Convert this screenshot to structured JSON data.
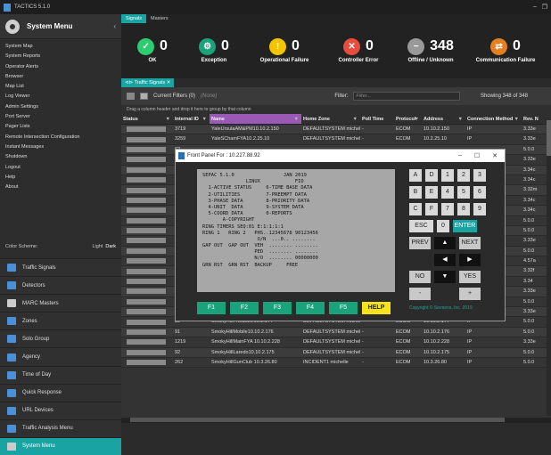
{
  "app": {
    "title": "TACTICS 5.1.0"
  },
  "system_menu": {
    "title": "System Menu",
    "items": [
      "System Map",
      "System Reports",
      "Operator Alerts",
      "Browser",
      "Map List",
      "Log Viewer",
      "Admin Settings",
      "Port Server",
      "Pager Lists",
      "Remote Intersection Configuration",
      "Instant Messages",
      "Shutdown",
      "Logout",
      "Help",
      "About"
    ]
  },
  "color_scheme": {
    "label": "Color Scheme:",
    "options": [
      "Light",
      "Dark"
    ]
  },
  "nav": [
    {
      "label": "Traffic Signals",
      "color": "#4a90d9"
    },
    {
      "label": "Detectors",
      "color": "#4a90d9"
    },
    {
      "label": "MARC Masters",
      "color": "#cccccc"
    },
    {
      "label": "Zones",
      "color": "#4a90d9"
    },
    {
      "label": "Solo Group",
      "color": "#4a90d9"
    },
    {
      "label": "Agency",
      "color": "#4a90d9"
    },
    {
      "label": "Time of Day",
      "color": "#4a90d9"
    },
    {
      "label": "Quick Response",
      "color": "#4a90d9"
    },
    {
      "label": "URL Devices",
      "color": "#4a90d9"
    },
    {
      "label": "Traffic Analysis Menu",
      "color": "#4a90d9"
    },
    {
      "label": "System Menu",
      "color": "#cccccc"
    }
  ],
  "tabs": [
    "Signals",
    "Masters"
  ],
  "status": [
    {
      "count": "0",
      "label": "OK",
      "color": "#2ecc71",
      "glyph": "✓"
    },
    {
      "count": "0",
      "label": "Exception",
      "color": "#1aa37a",
      "glyph": "⚙"
    },
    {
      "count": "0",
      "label": "Operational Failure",
      "color": "#f5c400",
      "glyph": "!"
    },
    {
      "count": "0",
      "label": "Controller Error",
      "color": "#e74c3c",
      "glyph": "✕"
    },
    {
      "count": "348",
      "label": "Offline / Unknown",
      "color": "#999999",
      "glyph": "−"
    },
    {
      "count": "0",
      "label": "Communication Failure",
      "color": "#e67e22",
      "glyph": "⇄"
    }
  ],
  "subtab": "Traffic Signals",
  "toolbar": {
    "current_filters": "Current Filters (0)",
    "none": "(None)",
    "filter_label": "Filter:",
    "filter_placeholder": "Filter...",
    "showing": "Showing 348 of 348"
  },
  "group_hint": "Drag a column header and drop it here to group by that column",
  "columns": [
    "Status",
    "Internal ID",
    "Name",
    "Home Zone",
    "Poll Time",
    "Protocol",
    "Address",
    "Connection Method",
    "Rev. N"
  ],
  "rows": [
    [
      "3719",
      "YaleUrsulaAM&PM10.10.2.150",
      "DEFAULTSYSTEM michelle",
      "-",
      "ECOM",
      "10.10.2.150",
      "IP",
      "3.33e"
    ],
    [
      "3259",
      "YaleSChamFYA10.2.25.10",
      "DEFAULTSYSTEM michelle",
      "-",
      "ECOM",
      "10.2.25.10",
      "IP",
      "3.33e"
    ],
    [
      "62",
      "",
      "",
      "",
      "",
      "",
      "",
      "5.0.0"
    ],
    [
      "3229",
      "",
      "",
      "",
      "",
      "",
      "",
      "3.33e"
    ],
    [
      "1329",
      "",
      "",
      "",
      "",
      "",
      "",
      "3.34c"
    ],
    [
      "11129",
      "",
      "",
      "",
      "",
      "",
      "",
      "3.34c"
    ],
    [
      "2709",
      "",
      "",
      "",
      "",
      "",
      "",
      "3.32m"
    ],
    [
      "1509",
      "",
      "",
      "",
      "",
      "",
      "",
      "3.34c"
    ],
    [
      "2519",
      "",
      "",
      "",
      "",
      "",
      "",
      "3.34c"
    ],
    [
      "94",
      "",
      "",
      "",
      "",
      "",
      "",
      "5.0.0"
    ],
    [
      "10",
      "",
      "",
      "",
      "",
      "",
      "",
      "5.0.0"
    ],
    [
      "1549",
      "",
      "",
      "",
      "",
      "",
      "",
      "3.33e"
    ],
    [
      "11189",
      "",
      "",
      "",
      "",
      "",
      "",
      "5.0.0"
    ],
    [
      "10979",
      "",
      "",
      "",
      "",
      "",
      "",
      "4.57a"
    ],
    [
      "2039",
      "",
      "",
      "",
      "",
      "",
      "",
      "3.32f"
    ],
    [
      "3409",
      "",
      "",
      "",
      "",
      "",
      "",
      "3.34"
    ],
    [
      "2749",
      "SterlingHillsTower 10.10.2.244",
      "DEFAULTSYSTEM michelle",
      "-",
      "ECOM",
      "10.10.2.244",
      "IP",
      "3.33e"
    ],
    [
      "93",
      "SmokyHillTufts10.2.26.40",
      "DEFAULTSYSTEM michelle",
      "-",
      "ECOM",
      "10.2.26.40",
      "IP",
      "5.0.0"
    ],
    [
      "2419",
      "SmokyHillTynFreFYA10.10.2.232",
      "DEFAULTSYSTEM michelle",
      "-",
      "ECOM",
      "10.10.2.232",
      "IP",
      "3.33e"
    ],
    [
      "89",
      "SmokyHillPheas10.10.2.177",
      "DEFAULTSYSTEM michelle",
      "-",
      "ECOM",
      "10.10.2.177",
      "IP",
      "5.0.0"
    ],
    [
      "91",
      "SmokyHillMobile10.10.2.176",
      "DEFAULTSYSTEM michelle",
      "-",
      "ECOM",
      "10.10.2.176",
      "IP",
      "5.0.0"
    ],
    [
      "1219",
      "SmokyHillMainFYA 10.10.2.228",
      "DEFAULTSYSTEM michelle",
      "-",
      "ECOM",
      "10.10.2.228",
      "IP",
      "3.33e"
    ],
    [
      "92",
      "SmokyHillLaredo10.10.2.175",
      "DEFAULTSYSTEM michelle",
      "-",
      "ECOM",
      "10.10.2.175",
      "IP",
      "5.0.0"
    ],
    [
      "262",
      "SmokyHillGunClub 10.3.26.80",
      "INCIDENT1 michelle",
      "-",
      "ECOM",
      "10.3.26.80",
      "IP",
      "5.0.0"
    ]
  ],
  "front_panel": {
    "title": "Front Panel For : 10.227.88.92",
    "lcd_lines": [
      "SEPAC 5.1.0                 JAN 2019",
      "               LINUX            FIO",
      "  1-ACTIVE STATUS     6-TIME BASE DATA",
      "  2-UTILITIES         7-PREEMPT DATA",
      "  3-PHASE DATA        8-PRIORITY DATA",
      "  4-UNIT  DATA        9-SYSTEM DATA",
      "  5-COORD DATA        0-REPORTS",
      "       A-COPYRIGHT",
      "RING TIMERS SEQ:01 E:1:1:1:1",
      "RING 1   RING 2   PHS..12345678 90123456",
      "                   O/N  ...0.. ........",
      "GAP OUT  GAP OUT  VEH  ........ ........",
      "                  PED  ........ ........",
      "                  N/O  ........ 00000000",
      "GRN RST  GRN RST  BACKUP     FREE"
    ],
    "fkeys": [
      "F1",
      "F2",
      "F3",
      "F4",
      "F5",
      "HELP"
    ],
    "keys": {
      "row1": [
        "A",
        "D",
        "1",
        "2",
        "3"
      ],
      "row2": [
        "B",
        "E",
        "4",
        "5",
        "6"
      ],
      "row3": [
        "C",
        "F",
        "7",
        "8",
        "9"
      ],
      "esc": "ESC",
      "zero": "0",
      "enter": "ENTER",
      "prev": "PREV",
      "next": "NEXT",
      "no": "NO",
      "yes": "YES",
      "minus": "-",
      "plus": "+"
    },
    "copyright": "Copyright © Siemens, Inc. 2019"
  }
}
